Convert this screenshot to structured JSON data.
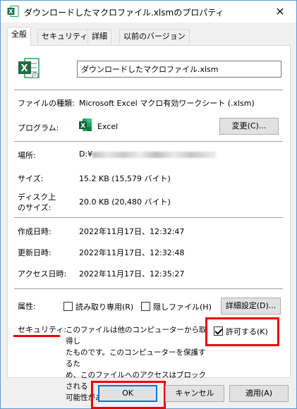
{
  "window": {
    "title": "ダウンロードしたマクロファイル.xlsmのプロパティ",
    "close_glyph": "✕"
  },
  "tabs": [
    {
      "label": "全般",
      "active": true
    },
    {
      "label": "セキュリティ",
      "active": false
    },
    {
      "label": "詳細",
      "active": false
    },
    {
      "label": "以前のバージョン",
      "active": false
    }
  ],
  "general": {
    "file_name": "ダウンロードしたマクロファイル.xlsm",
    "file_type_label": "ファイルの種類:",
    "file_type_value": "Microsoft Excel マクロ有効ワークシート (.xlsm)",
    "program_label": "プログラム:",
    "program_value": "Excel",
    "change_button": "変更(C)...",
    "location_label": "場所:",
    "location_value": "D:¥",
    "size_label": "サイズ:",
    "size_value": "15.2 KB (15,579 バイト)",
    "disk_size_label_1": "ディスク上",
    "disk_size_label_2": "のサイズ:",
    "disk_size_value": "20.0 KB (20,480 バイト)",
    "created_label": "作成日時:",
    "created_value": "2022年11月17日、12:32:47",
    "modified_label": "更新日時:",
    "modified_value": "2022年11月17日、12:32:48",
    "accessed_label": "アクセス日時:",
    "accessed_value": "2022年11月17日、12:35:27",
    "attributes_label": "属性:",
    "readonly_label": "読み取り専用(R)",
    "readonly_checked": false,
    "hidden_label": "隠しファイル(H)",
    "hidden_checked": false,
    "advanced_button": "詳細設定(D)...",
    "security_label": "セキュリティ:",
    "security_text_lines": [
      "このファイルは他のコンピューターから取得し",
      "たものです。このコンピューターを保護するた",
      "め、このファイルへのアクセスはブロックされる",
      "可能性があります。"
    ],
    "unblock_label": "許可する(K)",
    "unblock_checked": true
  },
  "footer": {
    "ok": "OK",
    "cancel": "キャンセル",
    "apply": "適用(A)"
  },
  "colors": {
    "highlight": "#e00000",
    "excel_green": "#1d6f42"
  },
  "icons": {
    "title": "excel-file-icon",
    "file": "excel-macro-file-icon",
    "program": "excel-app-icon"
  }
}
